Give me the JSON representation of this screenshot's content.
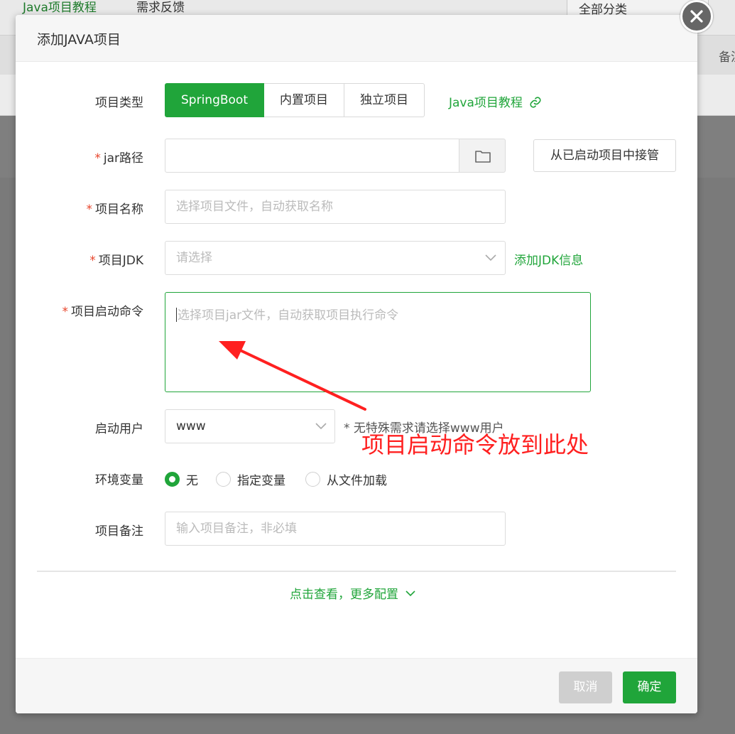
{
  "background": {
    "link_tutorial": "Java项目教程",
    "link_feedback": "需求反馈",
    "category_select": "全部分类",
    "note_partial": "备注"
  },
  "dialog": {
    "title": "添加JAVA项目",
    "project_type": {
      "label": "项目类型",
      "options": [
        "SpringBoot",
        "内置项目",
        "独立项目"
      ],
      "selected": "SpringBoot",
      "tutorial_link": "Java项目教程"
    },
    "jar_path": {
      "label": "jar路径",
      "value": "",
      "takeover_button": "从已启动项目中接管"
    },
    "project_name": {
      "label": "项目名称",
      "placeholder": "选择项目文件，自动获取名称"
    },
    "project_jdk": {
      "label": "项目JDK",
      "placeholder": "请选择",
      "add_link": "添加JDK信息"
    },
    "start_command": {
      "label": "项目启动命令",
      "placeholder": "选择项目jar文件，自动获取项目执行命令"
    },
    "start_user": {
      "label": "启动用户",
      "value": "www",
      "hint": "* 无特殊需求请选择www用户"
    },
    "env_vars": {
      "label": "环境变量",
      "options": [
        "无",
        "指定变量",
        "从文件加载"
      ],
      "selected": "无"
    },
    "remark": {
      "label": "项目备注",
      "placeholder": "输入项目备注，非必填"
    },
    "more_config": "点击查看，更多配置",
    "buttons": {
      "cancel": "取消",
      "confirm": "确定"
    }
  },
  "annotation": {
    "text": "项目启动命令放到此处"
  },
  "colors": {
    "accent": "#20a53a",
    "required": "#e8452c",
    "annotation": "#ff2020"
  }
}
